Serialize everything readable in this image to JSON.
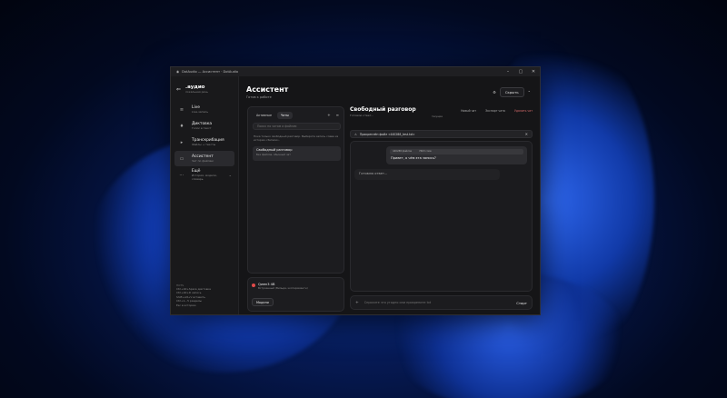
{
  "window": {
    "title": "DotAudio — Ассистент · DotAudio"
  },
  "brand": {
    "name": ".аудио",
    "sub": "локальная речь"
  },
  "nav": [
    {
      "label": "Live",
      "desc": "Live-запись",
      "icon": "waveform-icon"
    },
    {
      "label": "Диктовка",
      "desc": "Голос в текст",
      "icon": "mic-icon"
    },
    {
      "label": "Транскрибация",
      "desc": "Файлы → тексты",
      "icon": "play-icon"
    },
    {
      "label": "Ассистент",
      "desc": "Чат по файлам",
      "icon": "chat-icon"
    },
    {
      "label": "Ещё",
      "desc": "История, модели, словарь",
      "icon": "more-icon"
    }
  ],
  "hotkeys": {
    "title": "HOTS",
    "lines": [
      "Ctrl+Alt+Space диктовка",
      "Ctrl+Alt+D запись",
      "Shift+Alt+V вставить",
      "Ctrl+1...5 разделы",
      "Esc в историю"
    ]
  },
  "page": {
    "title": "Ассистент",
    "sub": "Готов к работе"
  },
  "actions": {
    "icon_btn": "⚙",
    "hide": "Скрыть",
    "collapse": "⌃"
  },
  "chatlist": {
    "tab_active": "Активные",
    "tab_chats": "Чаты",
    "search_placeholder": "Поиск по чатам и файлам",
    "hint": "Пока только свободный разговор. Выберите запись слева из истории «Записи».",
    "items": [
      {
        "title": "Свободный разговор",
        "sub": "Без файлов, обычный чат"
      }
    ]
  },
  "model": {
    "name": "Qwen3 4B",
    "desc": "Встроенный (Вильда, экспериментн)",
    "button": "Модели"
  },
  "chat": {
    "title": "Свободный разговор",
    "status": "Готовлю ответ...",
    "mini_tag": "текущие",
    "action_new": "Новый чат",
    "action_export": "Экспорт чата",
    "action_delete": "Удалить чат",
    "file_label": "Прикреплён файл «440288_test.txt»",
    "user_attach_name": "440288 файлов",
    "user_attach_size": "7663 слов",
    "user_text": "Привет, о чём эта запись?",
    "assist_text": "Готовлю ответ..."
  },
  "composer": {
    "placeholder": "Спросите что угодно или прикрепите txt",
    "send": "Старт"
  }
}
